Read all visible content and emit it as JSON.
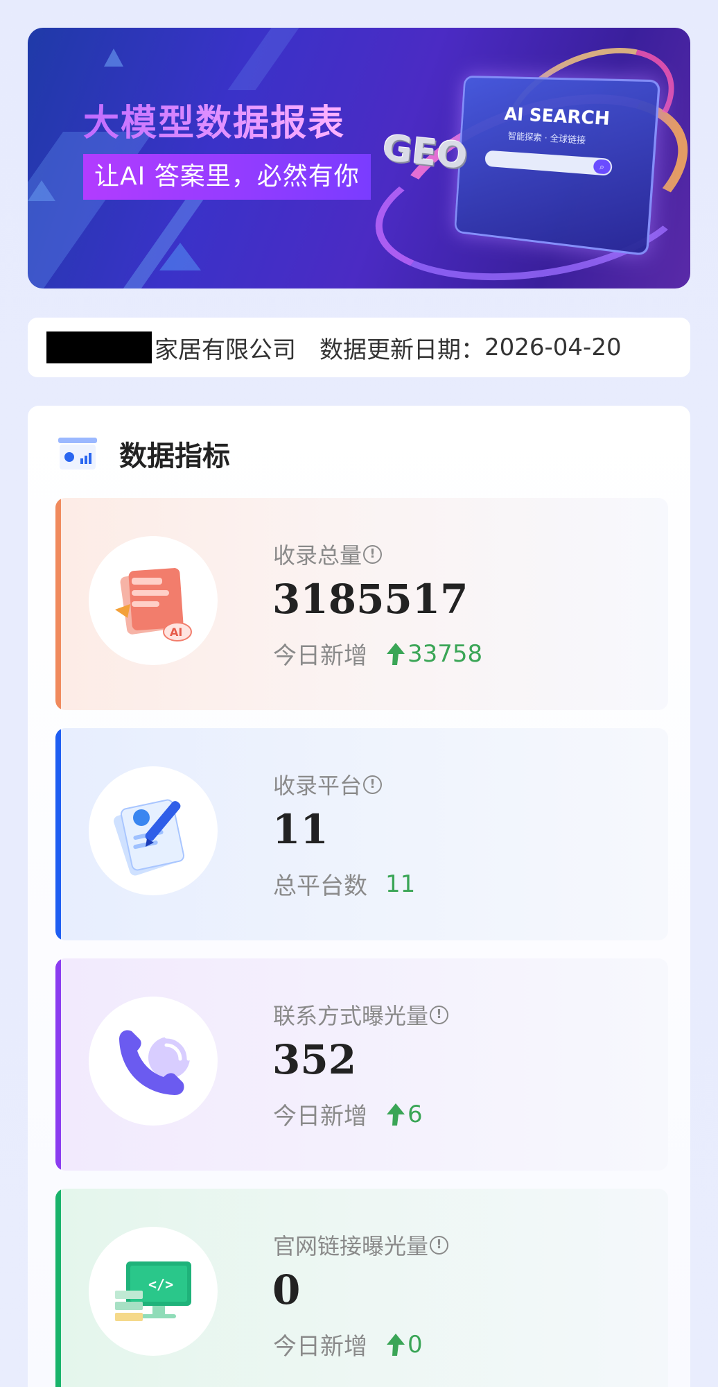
{
  "banner": {
    "title": "大模型数据报表",
    "subtitle": "让AI 答案里，必然有你",
    "geo_text": "GEO",
    "screen_title": "AI SEARCH",
    "screen_subtitle": "智能探索 · 全球链接"
  },
  "info_bar": {
    "company_suffix": "家居有限公司",
    "update_label": "数据更新日期：",
    "update_date": "2026-04-20"
  },
  "section": {
    "title": "数据指标",
    "icon": "chart-icon"
  },
  "cards": [
    {
      "label": "收录总量",
      "value": "3185517",
      "sub_label": "今日新增",
      "sub_value": "33758",
      "show_arrow": true,
      "accent": "#f08a5d",
      "icon": "document-ai-icon"
    },
    {
      "label": "收录平台",
      "value": "11",
      "sub_label": "总平台数",
      "sub_value": "11",
      "show_arrow": false,
      "accent": "#1f5ef2",
      "icon": "notepad-pen-icon"
    },
    {
      "label": "联系方式曝光量",
      "value": "352",
      "sub_label": "今日新增",
      "sub_value": "6",
      "show_arrow": true,
      "accent": "#8b3cf0",
      "icon": "phone-icon"
    },
    {
      "label": "官网链接曝光量",
      "value": "0",
      "sub_label": "今日新增",
      "sub_value": "0",
      "show_arrow": true,
      "accent": "#19b36b",
      "icon": "monitor-code-icon"
    }
  ],
  "colors": {
    "increase_green": "#3aa556",
    "label_gray": "#8a8a8a"
  }
}
